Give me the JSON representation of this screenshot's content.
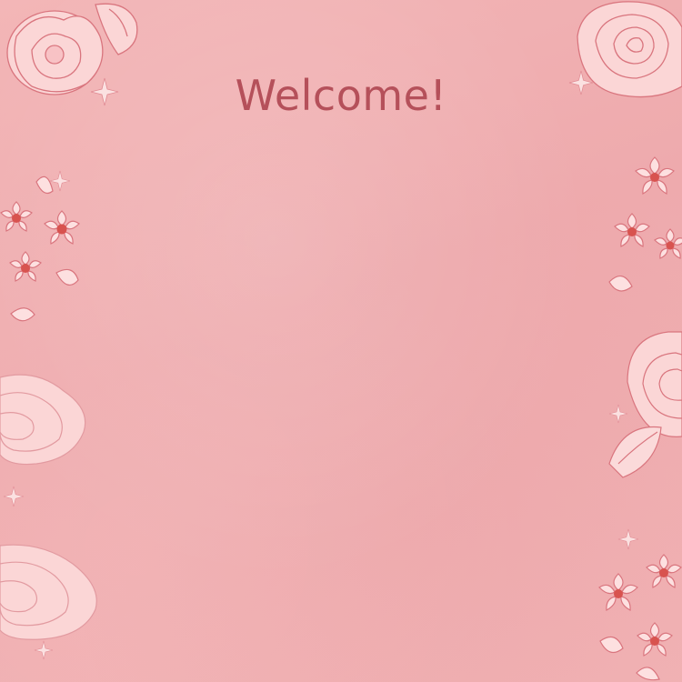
{
  "greeting": {
    "title": "Welcome!"
  },
  "colors": {
    "background": "#f0aeb0",
    "title": "#b5505a",
    "flower_fill": "#fbd3d4",
    "flower_outline": "#d9757e",
    "flower_center": "#d8534f"
  },
  "decorations": {
    "left_border": [
      "peony-icon",
      "cherry-blossom-icon",
      "peony-icon",
      "peony-icon"
    ],
    "right_border": [
      "rose-icon",
      "cherry-blossom-icon",
      "rose-icon",
      "cherry-blossom-icon"
    ],
    "sparkles": "sparkle-icon"
  }
}
